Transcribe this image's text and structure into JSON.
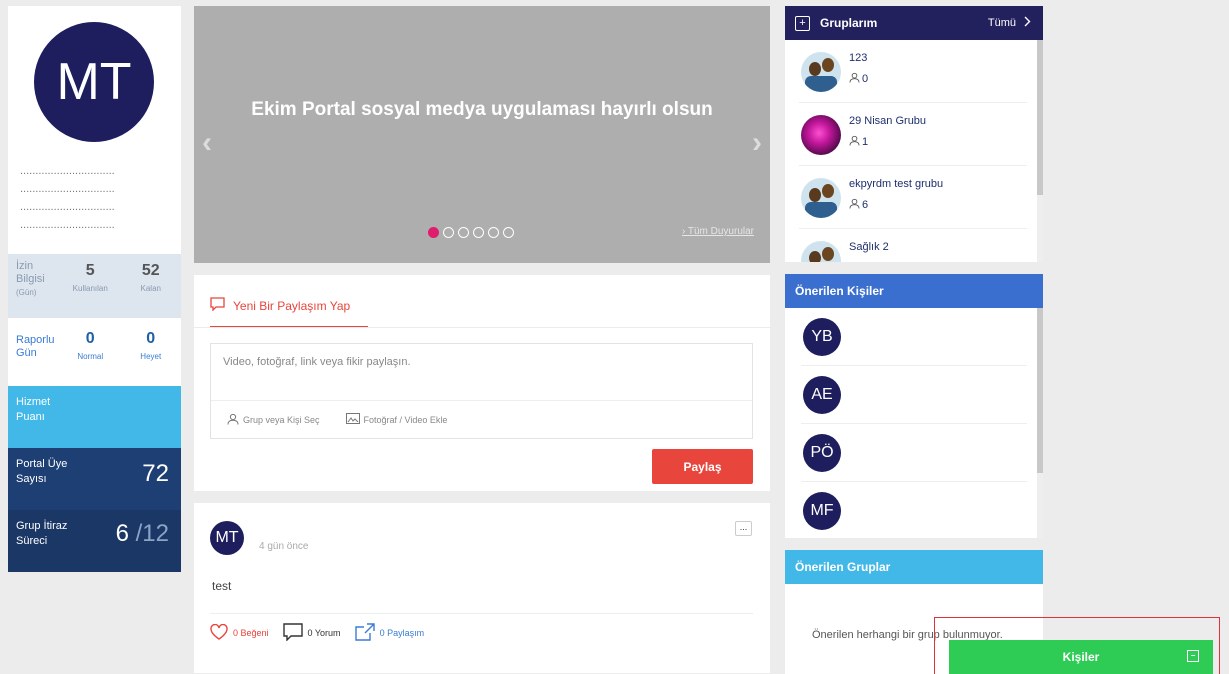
{
  "profile": {
    "initials": "MT",
    "dotted_lines": [
      "...............................",
      "...............................",
      "...............................",
      "..............................."
    ]
  },
  "leave": {
    "label_lines": [
      "İzin",
      "Bilgisi",
      "(Gün)"
    ],
    "used_value": "5",
    "used_label": "Kullanılan",
    "remaining_value": "52",
    "remaining_label": "Kalan"
  },
  "report": {
    "label_lines": [
      "Raporlu",
      "Gün"
    ],
    "normal_value": "0",
    "normal_label": "Normal",
    "committee_value": "0",
    "committee_label": "Heyet"
  },
  "service": {
    "label_lines": [
      "Hizmet",
      "Puanı"
    ]
  },
  "members": {
    "label_lines": [
      "Portal Üye",
      "Sayısı"
    ],
    "value": "72"
  },
  "appeal": {
    "label_lines": [
      "Grup İtiraz",
      "Süreci"
    ],
    "current": "6",
    "total": "/12"
  },
  "carousel": {
    "title": "Ekim Portal sosyal medya uygulaması hayırlı olsun",
    "prev": "‹",
    "next": "›",
    "slide_count": 6,
    "active_slide": 1,
    "all_link": "› Tüm Duyurular"
  },
  "share": {
    "tab_label": "Yeni Bir Paylaşım Yap",
    "placeholder": "Video, fotoğraf, link veya fikir paylaşın.",
    "select_label": "Grup veya Kişi Seç",
    "media_label": "Fotoğraf / Video Ekle",
    "button": "Paylaş"
  },
  "post": {
    "author_initials": "MT",
    "time": "4 gün önce",
    "more": "...",
    "text": "test",
    "likes": "0 Beğeni",
    "comments": "0 Yorum",
    "shares": "0 Paylaşım"
  },
  "groups": {
    "title": "Gruplarım",
    "all": "Tümü",
    "items": [
      {
        "name": "123",
        "count": "0",
        "avatar": "people"
      },
      {
        "name": "29 Nisan Grubu",
        "count": "1",
        "avatar": "flower"
      },
      {
        "name": "ekpyrdm test grubu",
        "count": "6",
        "avatar": "people"
      },
      {
        "name": "Sağlık 2",
        "count": "",
        "avatar": "people"
      }
    ]
  },
  "people": {
    "title": "Önerilen Kişiler",
    "items": [
      "YB",
      "AE",
      "PÖ",
      "MF"
    ]
  },
  "suggested_groups": {
    "title": "Önerilen Gruplar",
    "empty_text": "Önerilen herhangi bir grup bulunmuyor."
  },
  "chat": {
    "label": "Kişiler",
    "minimize": "−"
  },
  "colors": {
    "accent_red": "#e8453c",
    "navy": "#1e1e5e",
    "green": "#2ecc55",
    "cyan": "#42b8e9"
  }
}
